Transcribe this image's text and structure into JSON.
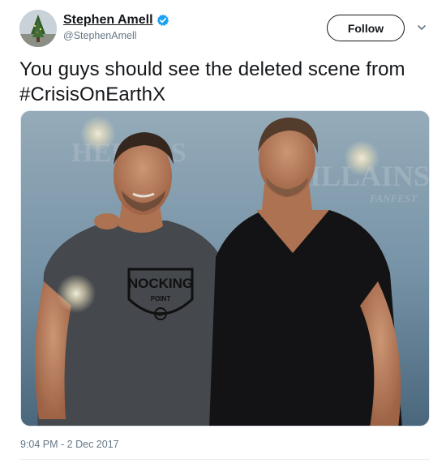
{
  "user": {
    "display_name": "Stephen Amell",
    "handle": "@StephenAmell",
    "verified": true,
    "avatar_icon": "profile-photo"
  },
  "actions": {
    "follow_label": "Follow",
    "more_icon": "chevron-down-icon"
  },
  "tweet": {
    "text_before": "You guys should see the deleted scene from ",
    "hashtag": "#CrisisOnEarthX",
    "timestamp": "9:04 PM - 2 Dec 2017"
  },
  "photo": {
    "backdrop_text": [
      "HEROES",
      "VILLAINS",
      "FANFEST"
    ],
    "shirt_logo_text": [
      "NOCKING",
      "POINT",
      "NP"
    ]
  },
  "colors": {
    "text": "#14171a",
    "secondary": "#657786",
    "verified": "#1da1f2",
    "border": "#e1e8ed"
  }
}
